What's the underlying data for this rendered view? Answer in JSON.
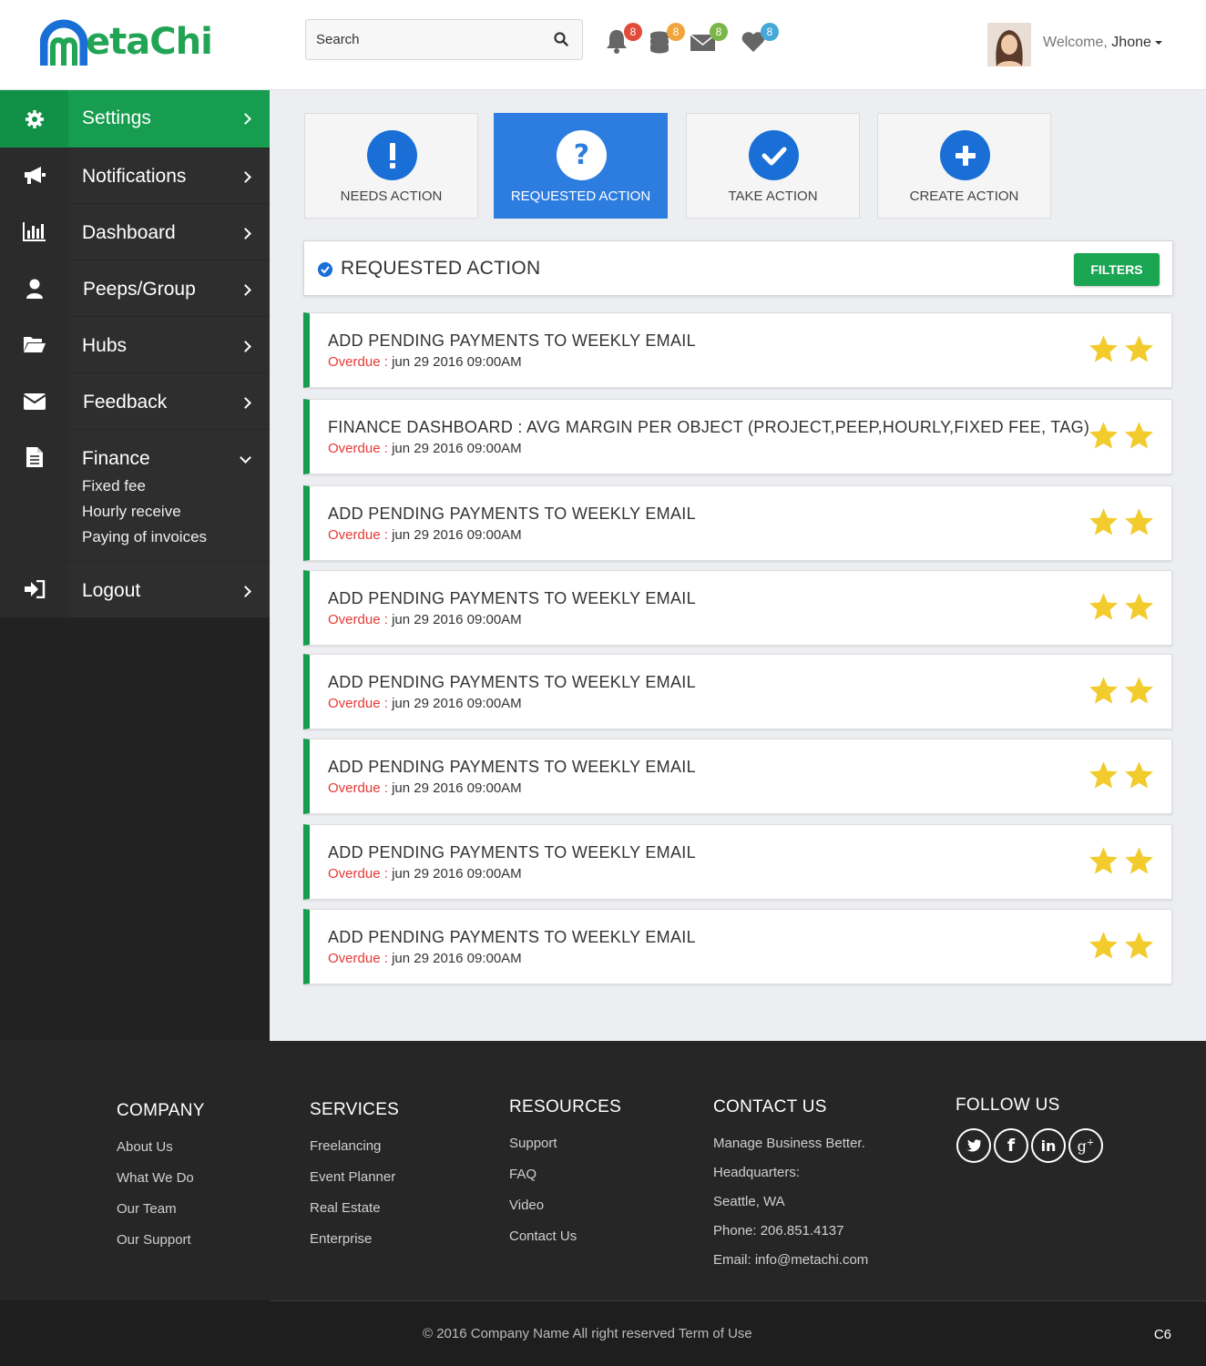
{
  "header": {
    "logo_prefix": "m",
    "logo_rest": "etaChi",
    "search_placeholder": "Search",
    "notifications": [
      {
        "icon": "bell-icon",
        "count": "8",
        "color": "#e04b3a"
      },
      {
        "icon": "coins-icon",
        "count": "8",
        "color": "#f0a63c"
      },
      {
        "icon": "mail-icon",
        "count": "8",
        "color": "#7ab648"
      },
      {
        "icon": "heart-icon",
        "count": "8",
        "color": "#45a8d6"
      }
    ],
    "welcome_label": "Welcome,",
    "user_name": "Jhone"
  },
  "sidebar": {
    "items": [
      {
        "label": "Settings",
        "icon": "gear-icon"
      },
      {
        "label": "Notifications",
        "icon": "megaphone-icon"
      },
      {
        "label": "Dashboard",
        "icon": "bar-chart-icon"
      },
      {
        "label": "Peeps/Group",
        "icon": "user-icon"
      },
      {
        "label": "Hubs",
        "icon": "folder-icon"
      },
      {
        "label": "Feedback",
        "icon": "envelope-icon"
      },
      {
        "label": "Finance",
        "icon": "document-icon",
        "sub": [
          "Fixed fee",
          "Hourly receive",
          "Paying of invoices"
        ]
      },
      {
        "label": "Logout",
        "icon": "sign-in-icon"
      }
    ]
  },
  "tiles": [
    {
      "label": "NEEDS ACTION",
      "icon": "exclamation-icon"
    },
    {
      "label": "REQUESTED ACTION",
      "icon": "question-icon"
    },
    {
      "label": "TAKE ACTION",
      "icon": "check-icon"
    },
    {
      "label": "CREATE ACTION",
      "icon": "plus-icon"
    }
  ],
  "panel": {
    "title": "REQUESTED ACTION",
    "filters_label": "FILTERS"
  },
  "actions": [
    {
      "title": "ADD PENDING PAYMENTS TO WEEKLY EMAIL",
      "status": "Overdue",
      "sep": " : ",
      "date": "jun 29 2016 09:00AM",
      "stars": 2
    },
    {
      "title": "FINANCE DASHBOARD : AVG MARGIN PER OBJECT (PROJECT,PEEP,HOURLY,FIXED FEE, TAG)",
      "status": "Overdue",
      "sep": " : ",
      "date": "jun 29 2016 09:00AM",
      "stars": 2
    },
    {
      "title": "ADD PENDING PAYMENTS TO WEEKLY EMAIL",
      "status": "Overdue",
      "sep": " : ",
      "date": "jun 29 2016 09:00AM",
      "stars": 2
    },
    {
      "title": "ADD PENDING PAYMENTS TO WEEKLY EMAIL",
      "status": "Overdue",
      "sep": " : ",
      "date": "jun 29 2016 09:00AM",
      "stars": 2
    },
    {
      "title": "ADD PENDING PAYMENTS TO WEEKLY EMAIL",
      "status": "Overdue",
      "sep": " : ",
      "date": "jun 29 2016 09:00AM",
      "stars": 2
    },
    {
      "title": "ADD PENDING PAYMENTS TO WEEKLY EMAIL",
      "status": "Overdue",
      "sep": " : ",
      "date": "jun 29 2016 09:00AM",
      "stars": 2
    },
    {
      "title": "ADD PENDING PAYMENTS TO WEEKLY EMAIL",
      "status": "Overdue",
      "sep": " : ",
      "date": "jun 29 2016 09:00AM",
      "stars": 2
    },
    {
      "title": "ADD PENDING PAYMENTS TO WEEKLY EMAIL",
      "status": "Overdue",
      "sep": " : ",
      "date": "jun 29 2016 09:00AM",
      "stars": 2
    }
  ],
  "footer": {
    "company": {
      "heading": "COMPANY",
      "links": [
        "About Us",
        "What We Do",
        "Our Team",
        "Our Support"
      ]
    },
    "services": {
      "heading": "SERVICES",
      "links": [
        "Freelancing",
        "Event Planner",
        "Real Estate",
        "Enterprise"
      ]
    },
    "resources": {
      "heading": "RESOURCES",
      "links": [
        "Support",
        "FAQ",
        "Video",
        "Contact Us"
      ]
    },
    "contact": {
      "heading": "CONTACT US",
      "lines": [
        "Manage Business Better.",
        "Headquarters:",
        "Seattle, WA",
        "Phone: 206.851.4137",
        "Email: info@metachi.com"
      ]
    },
    "follow": {
      "heading": "FOLLOW US",
      "icons": [
        "twitter-icon",
        "facebook-icon",
        "linkedin-icon",
        "google-plus-icon"
      ]
    },
    "copyright": "© 2016 Company Name  All right reserved  Term of Use",
    "code": "C6"
  },
  "colors": {
    "green": "#169d50",
    "blue": "#1a6fd6",
    "overdue": "#e53935",
    "star": "#f2cb2c"
  }
}
